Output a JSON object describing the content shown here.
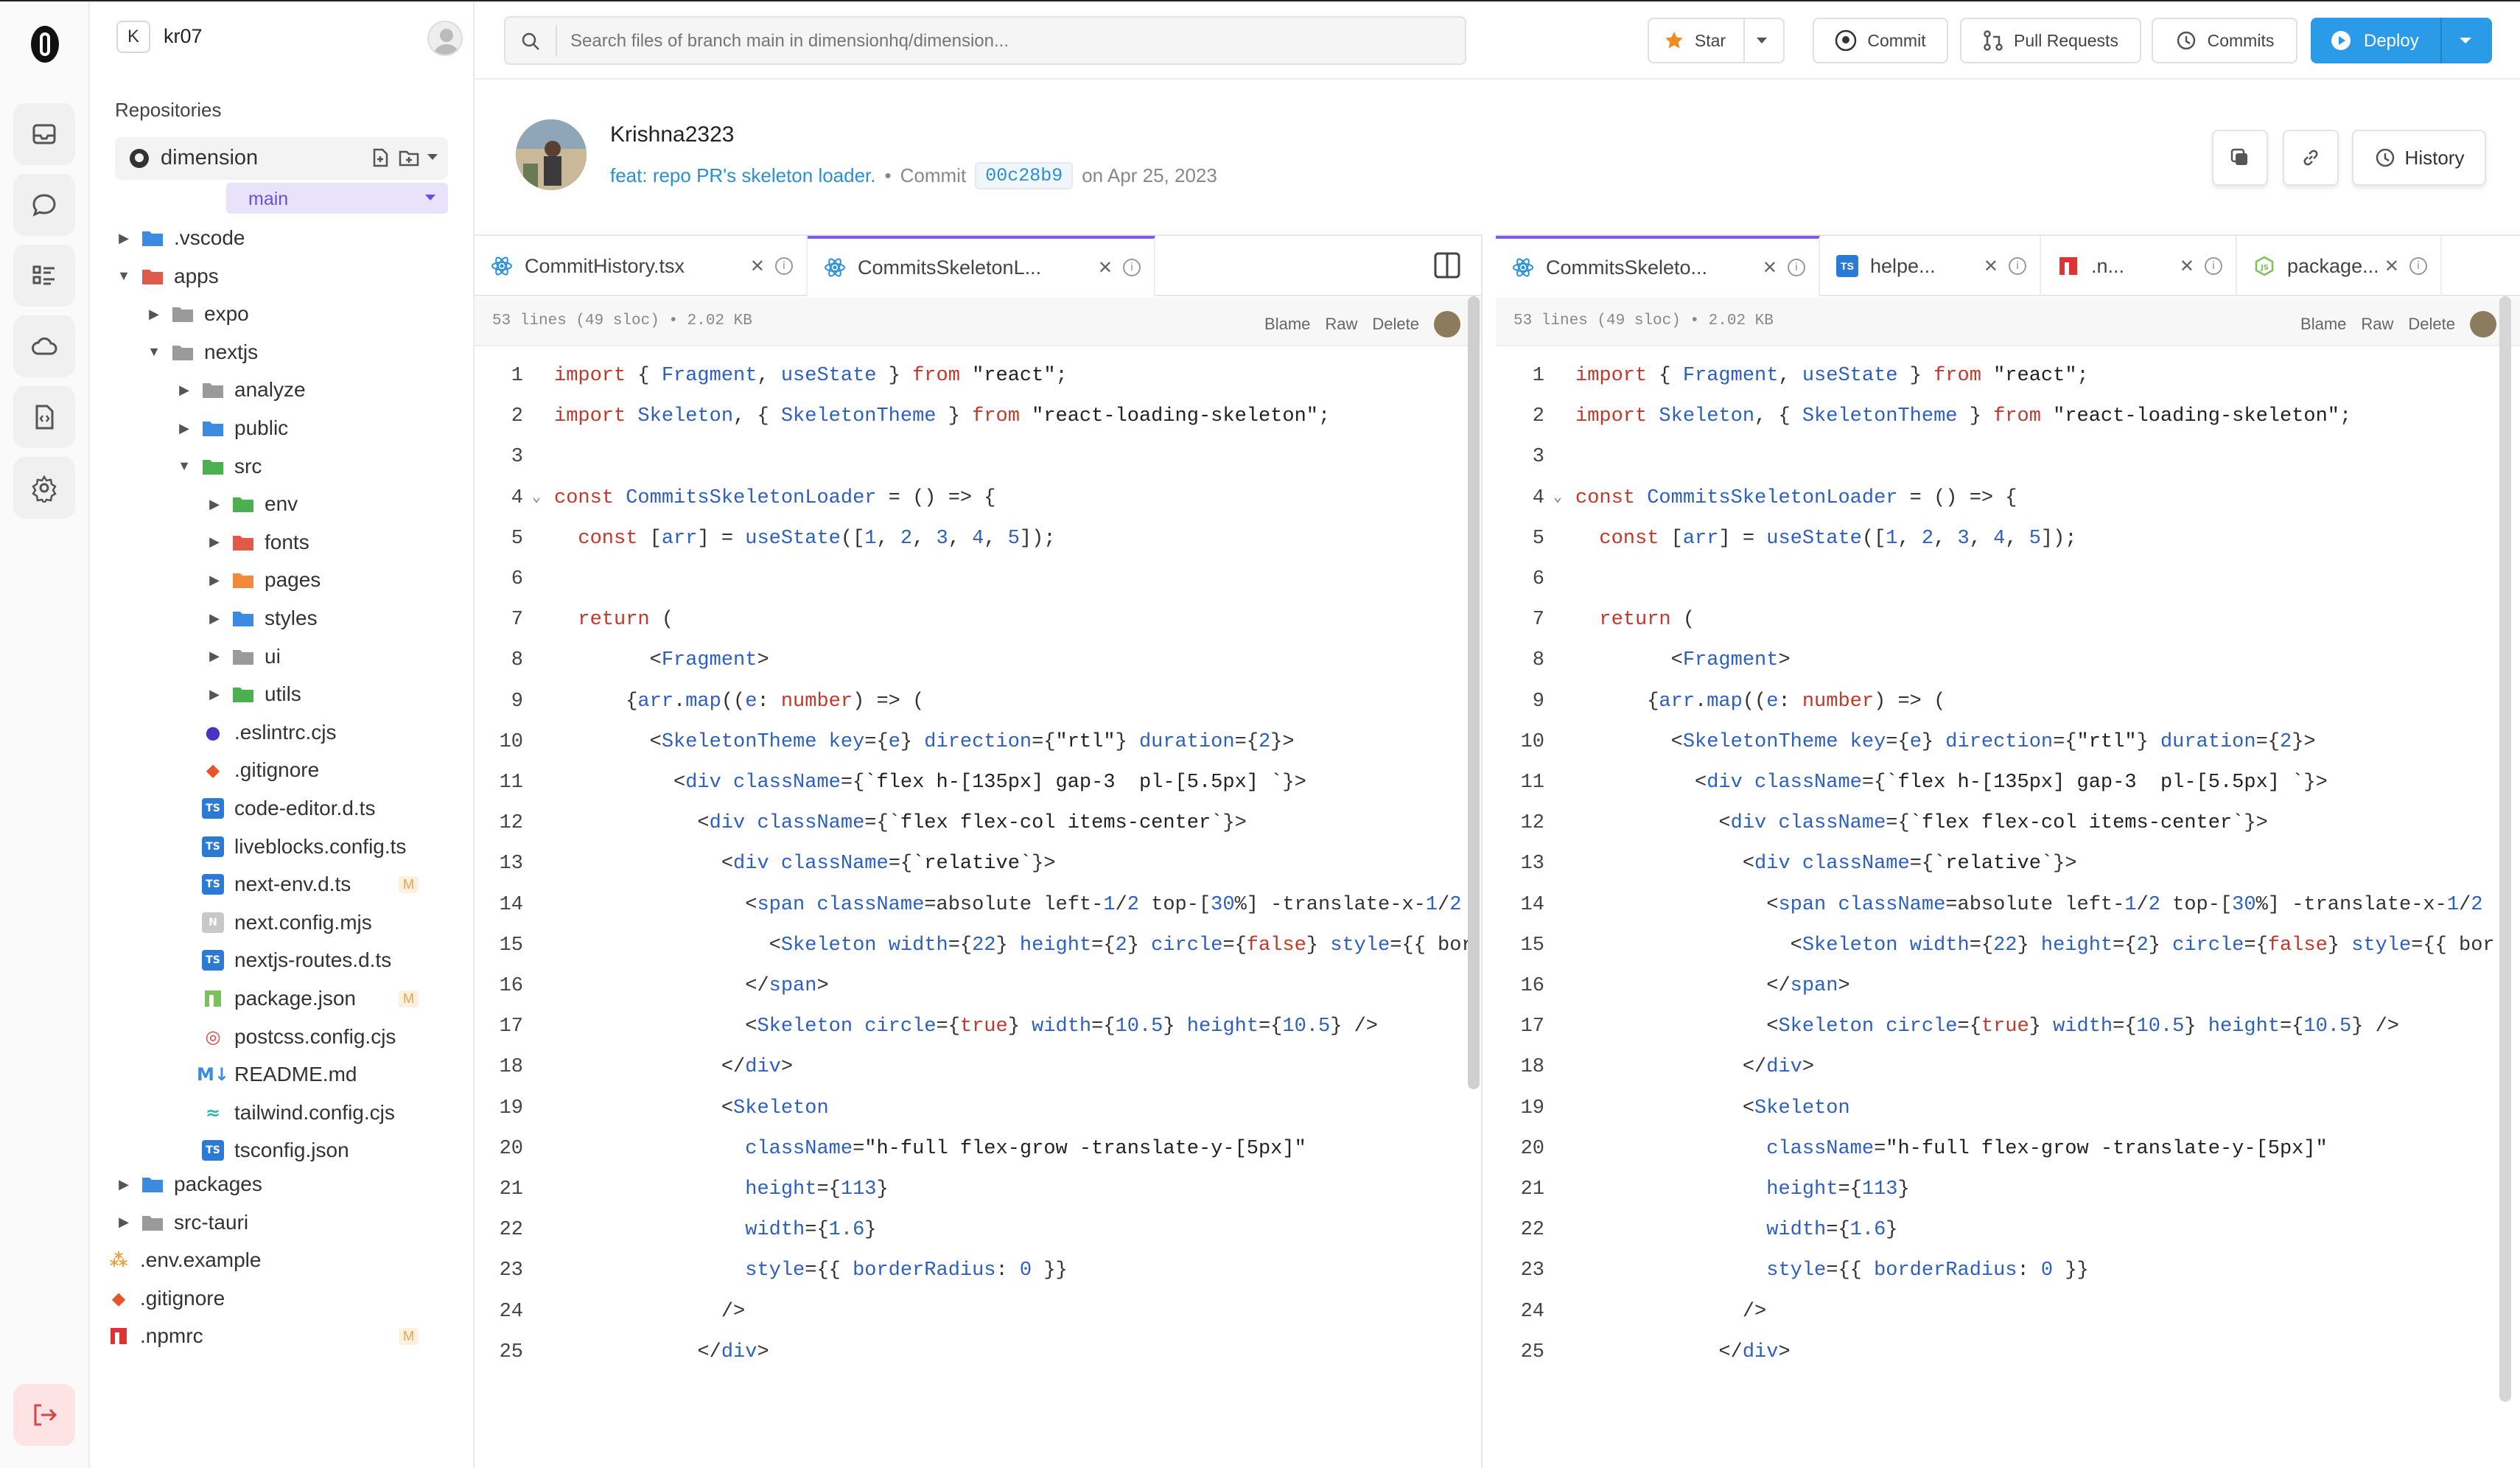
{
  "rail": {
    "icons": [
      "logo-icon",
      "inbox-icon",
      "chat-icon",
      "tasks-icon",
      "cloud-icon",
      "file-code-icon",
      "settings-icon",
      "logout-icon"
    ]
  },
  "user": {
    "initial": "K",
    "name": "kr07"
  },
  "sidebar": {
    "section_title": "Repositories",
    "repo": "dimension",
    "branch": "main",
    "tree": [
      {
        "label": ".vscode",
        "indent": 0,
        "arrow": "▶",
        "icon": "folder-blue",
        "color": "#3b8be0"
      },
      {
        "label": "apps",
        "indent": 0,
        "arrow": "▼",
        "icon": "folder-red",
        "color": "#e05a4a"
      },
      {
        "label": "expo",
        "indent": 1,
        "arrow": "▶",
        "icon": "folder",
        "color": "#9a9a9a"
      },
      {
        "label": "nextjs",
        "indent": 1,
        "arrow": "▼",
        "icon": "folder",
        "color": "#9a9a9a"
      },
      {
        "label": "analyze",
        "indent": 2,
        "arrow": "▶",
        "icon": "folder",
        "color": "#9a9a9a"
      },
      {
        "label": "public",
        "indent": 2,
        "arrow": "▶",
        "icon": "folder-blue",
        "color": "#3b8be0"
      },
      {
        "label": "src",
        "indent": 2,
        "arrow": "▼",
        "icon": "folder-green",
        "color": "#4caf50"
      },
      {
        "label": "env",
        "indent": 3,
        "arrow": "▶",
        "icon": "folder-green",
        "color": "#4caf50"
      },
      {
        "label": "fonts",
        "indent": 3,
        "arrow": "▶",
        "icon": "folder-red",
        "color": "#e05a4a"
      },
      {
        "label": "pages",
        "indent": 3,
        "arrow": "▶",
        "icon": "folder-orange",
        "color": "#f08a3c"
      },
      {
        "label": "styles",
        "indent": 3,
        "arrow": "▶",
        "icon": "folder-blue",
        "color": "#3b8be0"
      },
      {
        "label": "ui",
        "indent": 3,
        "arrow": "▶",
        "icon": "folder",
        "color": "#9a9a9a"
      },
      {
        "label": "utils",
        "indent": 3,
        "arrow": "▶",
        "icon": "folder-green",
        "color": "#4caf50"
      },
      {
        "label": ".eslintrc.cjs",
        "indent": 2,
        "arrow": "",
        "icon": "eslint",
        "color": "#4b32c3"
      },
      {
        "label": ".gitignore",
        "indent": 2,
        "arrow": "",
        "icon": "git",
        "color": "#e8552c"
      },
      {
        "label": "code-editor.d.ts",
        "indent": 2,
        "arrow": "",
        "icon": "ts",
        "color": "#2b7bd6"
      },
      {
        "label": "liveblocks.config.ts",
        "indent": 2,
        "arrow": "",
        "icon": "ts",
        "color": "#2b7bd6"
      },
      {
        "label": "next-env.d.ts",
        "indent": 2,
        "arrow": "",
        "icon": "ts",
        "color": "#2b7bd6",
        "badge": "M"
      },
      {
        "label": "next.config.mjs",
        "indent": 2,
        "arrow": "",
        "icon": "next",
        "color": "#c8c8c8"
      },
      {
        "label": "nextjs-routes.d.ts",
        "indent": 2,
        "arrow": "",
        "icon": "ts",
        "color": "#2b7bd6"
      },
      {
        "label": "package.json",
        "indent": 2,
        "arrow": "",
        "icon": "npm",
        "color": "#7cc05a",
        "badge": "M"
      },
      {
        "label": "postcss.config.cjs",
        "indent": 2,
        "arrow": "",
        "icon": "postcss",
        "color": "#e0443a"
      },
      {
        "label": "README.md",
        "indent": 2,
        "arrow": "",
        "icon": "markdown",
        "color": "#3b8be0"
      },
      {
        "label": "tailwind.config.cjs",
        "indent": 2,
        "arrow": "",
        "icon": "tailwind",
        "color": "#38b2ac"
      },
      {
        "label": "tsconfig.json",
        "indent": 2,
        "arrow": "",
        "icon": "tsconfig",
        "color": "#2b7bd6"
      },
      {
        "label": "packages",
        "indent": 0,
        "arrow": "▶",
        "icon": "folder-blue",
        "color": "#3b8be0"
      },
      {
        "label": "src-tauri",
        "indent": 0,
        "arrow": "▶",
        "icon": "folder",
        "color": "#9a9a9a"
      },
      {
        "label": ".env.example",
        "indent": -1,
        "arrow": "",
        "icon": "env",
        "color": "#e8a23c"
      },
      {
        "label": ".gitignore",
        "indent": -1,
        "arrow": "",
        "icon": "git",
        "color": "#e8552c"
      },
      {
        "label": ".npmrc",
        "indent": -1,
        "arrow": "",
        "icon": "npm",
        "color": "#d33",
        "badge": "M"
      }
    ]
  },
  "search": {
    "placeholder": "Search files of branch main in dimensionhq/dimension..."
  },
  "toolbar": {
    "star": "Star",
    "commit": "Commit",
    "pull_requests": "Pull Requests",
    "commits": "Commits",
    "deploy": "Deploy"
  },
  "commit": {
    "author": "Krishna2323",
    "message": "feat: repo PR's skeleton loader.",
    "sep": "•",
    "label": "Commit",
    "hash": "00c28b9",
    "date": "on Apr 25, 2023"
  },
  "header_buttons": {
    "history": "History"
  },
  "left_pane": {
    "tabs": [
      {
        "label": "CommitHistory.tsx",
        "icon": "react"
      },
      {
        "label": "CommitsSkeletonL...",
        "icon": "react",
        "active": true
      }
    ],
    "meta": "53 lines (49 sloc) • 2.02 KB",
    "actions": [
      "Blame",
      "Raw",
      "Delete"
    ]
  },
  "right_pane": {
    "tabs": [
      {
        "label": "CommitsSkeleto...",
        "icon": "react",
        "active": true
      },
      {
        "label": "helpe...",
        "icon": "ts"
      },
      {
        "label": ".n...",
        "icon": "npm"
      },
      {
        "label": "package...",
        "icon": "nodejs"
      }
    ],
    "meta": "53 lines (49 sloc) • 2.02 KB",
    "actions": [
      "Blame",
      "Raw",
      "Delete"
    ]
  },
  "code_lines": [
    "import { Fragment, useState } from \"react\";",
    "import Skeleton, { SkeletonTheme } from \"react-loading-skeleton\";",
    "",
    "const CommitsSkeletonLoader = () => {",
    "  const [arr] = useState([1, 2, 3, 4, 5]);",
    "",
    "  return (",
    "        <Fragment>",
    "      {arr.map((e: number) => (",
    "        <SkeletonTheme key={e} direction={\"rtl\"} duration={2}>",
    "          <div className={`flex h-[135px] gap-3  pl-[5.5px] `}>",
    "            <div className={`flex flex-col items-center`}>",
    "              <div className={`relative`}>",
    "                <span className=\"absolute left-1/2 top-[30%] -translate-x-1/2",
    "                  <Skeleton width={22} height={2} circle={false} style={{ bor",
    "                </span>",
    "                <Skeleton circle={true} width={10.5} height={10.5} />",
    "              </div>",
    "              <Skeleton",
    "                className=\"h-full flex-grow -translate-y-[5px]\"",
    "                height={113}",
    "                width={1.6}",
    "                style={{ borderRadius: 0 }}",
    "              />",
    "            </div>"
  ]
}
